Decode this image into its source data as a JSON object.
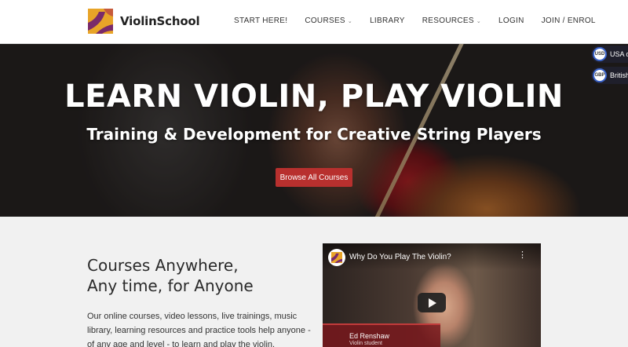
{
  "brand": {
    "name": "ViolinSchool",
    "colors": {
      "accent": "#b8302e",
      "logo_yellow": "#e8a428",
      "logo_purple": "#7a2a6a"
    }
  },
  "nav": {
    "items": [
      {
        "label": "START HERE!",
        "dropdown": false
      },
      {
        "label": "COURSES",
        "dropdown": true
      },
      {
        "label": "LIBRARY",
        "dropdown": false
      },
      {
        "label": "RESOURCES",
        "dropdown": true
      },
      {
        "label": "LOGIN",
        "dropdown": false
      },
      {
        "label": "JOIN / ENROL",
        "dropdown": false
      }
    ],
    "chevron_icon": "chevron-down-icon"
  },
  "currency": {
    "options": [
      {
        "code": "USD",
        "label": "USA do"
      },
      {
        "code": "GBP",
        "label": "British"
      }
    ]
  },
  "hero": {
    "title": "LEARN VIOLIN, PLAY VIOLIN",
    "subtitle": "Training & Development for Creative String Players",
    "cta_label": "Browse All Courses"
  },
  "intro": {
    "title_line1": "Courses Anywhere,",
    "title_line2": "Any time, for Anyone",
    "body": "Our online courses, video lessons, live trainings, music library, learning resources and practice tools help anyone - of any age and level - to learn and play the violin."
  },
  "video": {
    "title": "Why Do You Play The Violin?",
    "caption_name": "Ed Renshaw",
    "caption_role": "Violin student",
    "menu_icon": "more-vertical-icon",
    "play_icon": "play-icon"
  }
}
